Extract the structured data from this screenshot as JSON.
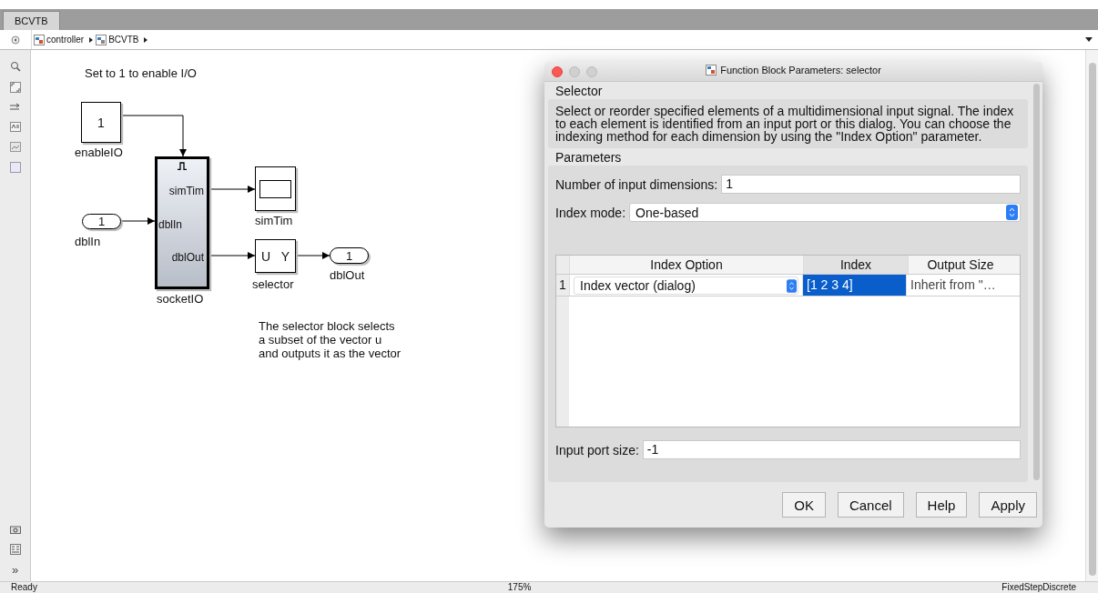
{
  "tabs": [
    {
      "label": "BCVTB",
      "selected": true
    }
  ],
  "toolbar_more": "»",
  "breadcrumb": [
    {
      "label": "controller"
    },
    {
      "label": "BCVTB"
    }
  ],
  "canvas": {
    "annotations": [
      "Set to 1 to enable I/O",
      "The selector block selects\na subset of the vector u\nand outputs it as the vector"
    ],
    "blocks": [
      {
        "kind": "constant",
        "value": "1",
        "label": "enableIO"
      },
      {
        "kind": "inport",
        "value": "1",
        "label": "dblIn"
      },
      {
        "kind": "subsystem",
        "label": "socketIO",
        "ports": [
          {
            "kind": "output",
            "label": "simTim"
          },
          {
            "kind": "input",
            "label": "dblIn"
          },
          {
            "kind": "output",
            "label": "dblOut"
          }
        ]
      },
      {
        "kind": "scope",
        "label": "simTim"
      },
      {
        "kind": "selector",
        "input": "U",
        "output": "Y",
        "label": "selector"
      },
      {
        "kind": "outport",
        "value": "1",
        "label": "dblOut"
      }
    ]
  },
  "dialog": {
    "title": "Function Block Parameters: selector",
    "section": "Selector",
    "description": "Select or reorder specified elements of a multidimensional input signal. The index to each element is identified from an input port or this dialog. You can choose the indexing method for each dimension by using the \"Index Option\" parameter.",
    "parameters_heading": "Parameters",
    "fields": [
      {
        "kind": "text",
        "label": "Number of input dimensions:",
        "value": "1"
      },
      {
        "kind": "select",
        "label": "Index mode:",
        "value": "One-based"
      }
    ],
    "table": {
      "columns": [
        "Index Option",
        "Index",
        "Output Size"
      ],
      "rows": [
        {
          "number": "1",
          "cells": [
            {
              "kind": "select",
              "text": "Index vector (dialog)",
              "selected": false
            },
            {
              "kind": "text",
              "text": "[1 2 3 4]",
              "selected": true
            },
            {
              "kind": "text",
              "text": "Inherit from \"…",
              "selected": false
            }
          ]
        }
      ]
    },
    "port_size": {
      "label": "Input port size:",
      "value": "-1"
    },
    "buttons": [
      "OK",
      "Cancel",
      "Help",
      "Apply"
    ]
  },
  "status_bar": [
    "Ready",
    "175%",
    "FixedStepDiscrete"
  ]
}
